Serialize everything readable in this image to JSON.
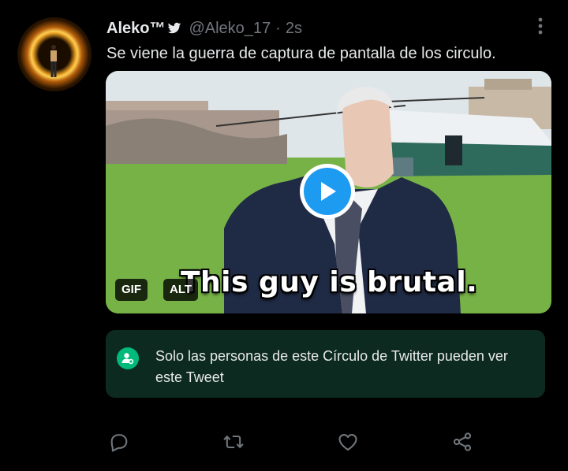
{
  "tweet": {
    "display_name": "Aleko™",
    "handle": "@Aleko_17",
    "separator": "·",
    "time": "2s",
    "text": "Se viene la guerra de captura de pantalla de los circulo."
  },
  "media": {
    "caption": "This guy is brutal.",
    "badges": {
      "gif": "GIF",
      "alt": "ALT"
    },
    "icon": "play-icon"
  },
  "circle_notice": {
    "text": "Solo las personas de este Círculo de Twitter pueden ver este Tweet",
    "icon": "circle-people-icon",
    "accent_color": "#00ba7c"
  },
  "actions": [
    "reply-icon",
    "retweet-icon",
    "like-icon",
    "share-icon"
  ],
  "colors": {
    "background": "#000000",
    "text": "#e7e9ea",
    "muted": "#71767b",
    "accent": "#1d9bf0"
  }
}
